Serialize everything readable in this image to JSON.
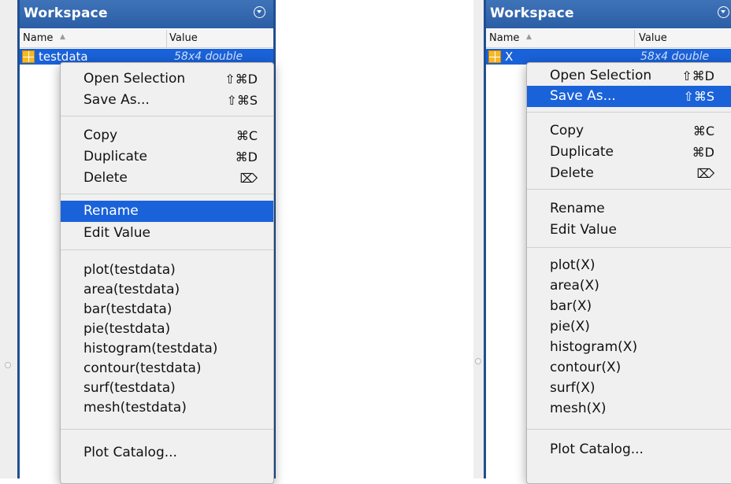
{
  "left": {
    "panel_title": "Workspace",
    "columns": {
      "name": "Name",
      "sort_indicator": "▲",
      "value": "Value"
    },
    "variable": {
      "name": "testdata",
      "value": "58x4 double"
    },
    "menu": {
      "open_selection": "Open Selection",
      "open_selection_sc": "⇧⌘D",
      "save_as": "Save As...",
      "save_as_sc": "⇧⌘S",
      "copy": "Copy",
      "copy_sc": "⌘C",
      "duplicate": "Duplicate",
      "duplicate_sc": "⌘D",
      "delete": "Delete",
      "delete_sc": "⌦",
      "rename": "Rename",
      "edit_value": "Edit Value",
      "plot": "plot(testdata)",
      "area": "area(testdata)",
      "bar": "bar(testdata)",
      "pie": "pie(testdata)",
      "histogram": "histogram(testdata)",
      "contour": "contour(testdata)",
      "surf": "surf(testdata)",
      "mesh": "mesh(testdata)",
      "plot_catalog": "Plot Catalog..."
    },
    "selected_item": "Rename"
  },
  "right": {
    "panel_title": "Workspace",
    "columns": {
      "name": "Name",
      "sort_indicator": "▲",
      "value": "Value"
    },
    "variable": {
      "name": "X",
      "value": "58x4 double"
    },
    "menu": {
      "open_selection": "Open Selection",
      "open_selection_sc": "⇧⌘D",
      "save_as": "Save As...",
      "save_as_sc": "⇧⌘S",
      "copy": "Copy",
      "copy_sc": "⌘C",
      "duplicate": "Duplicate",
      "duplicate_sc": "⌘D",
      "delete": "Delete",
      "delete_sc": "⌦",
      "rename": "Rename",
      "edit_value": "Edit Value",
      "plot": "plot(X)",
      "area": "area(X)",
      "bar": "bar(X)",
      "pie": "pie(X)",
      "histogram": "histogram(X)",
      "contour": "contour(X)",
      "surf": "surf(X)",
      "mesh": "mesh(X)",
      "plot_catalog": "Plot Catalog..."
    },
    "selected_item": "Save As..."
  },
  "colors": {
    "title_bar": "#2b5ea5",
    "selection": "#1a62d9",
    "menu_bg": "#f0f0f0"
  },
  "icons": {
    "variable_icon": "matrix-grid-icon",
    "panel_menu_icon": "chevron-circle-down-icon"
  }
}
